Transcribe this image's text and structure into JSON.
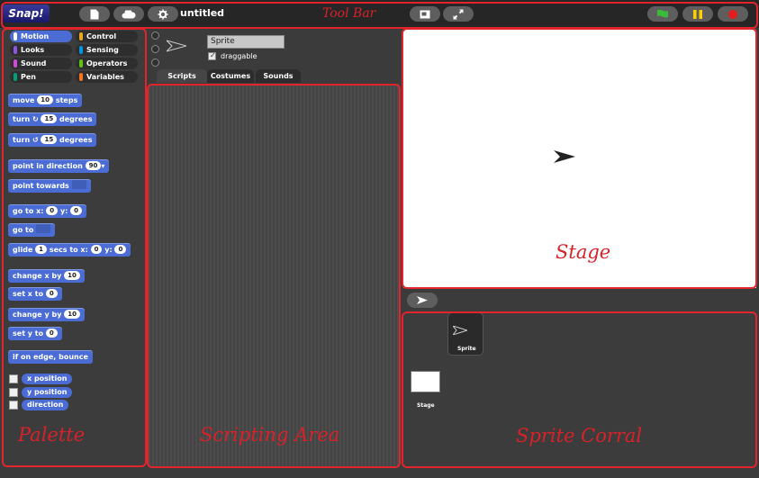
{
  "toolbar": {
    "logo_text": "Snap!",
    "project_title": "untitled"
  },
  "annotations": {
    "toolbar": "Tool Bar",
    "palette": "Palette",
    "scripting_area": "Scripting Area",
    "stage": "Stage",
    "sprite_corral": "Sprite Corral"
  },
  "categories": [
    {
      "label": "Motion",
      "color": "#4a6cd4"
    },
    {
      "label": "Control",
      "color": "#e6a822"
    },
    {
      "label": "Looks",
      "color": "#8f56e3"
    },
    {
      "label": "Sensing",
      "color": "#0494dc"
    },
    {
      "label": "Sound",
      "color": "#cf4ad9"
    },
    {
      "label": "Operators",
      "color": "#62c213"
    },
    {
      "label": "Pen",
      "color": "#00a178"
    },
    {
      "label": "Variables",
      "color": "#f3761d"
    }
  ],
  "blocks": {
    "move": {
      "pre": "move",
      "value": "10",
      "post": "steps"
    },
    "turn_cw": {
      "pre": "turn",
      "value": "15",
      "post": "degrees"
    },
    "turn_ccw": {
      "pre": "turn",
      "value": "15",
      "post": "degrees"
    },
    "point_dir": {
      "pre": "point in direction",
      "value": "90"
    },
    "point_towards": {
      "pre": "point towards"
    },
    "go_to_xy": {
      "pre": "go to x:",
      "x": "0",
      "mid": "y:",
      "y": "0"
    },
    "go_to": {
      "pre": "go to"
    },
    "glide": {
      "pre": "glide",
      "secs": "1",
      "mid1": "secs to x:",
      "x": "0",
      "mid2": "y:",
      "y": "0"
    },
    "change_x": {
      "pre": "change x by",
      "value": "10"
    },
    "set_x": {
      "pre": "set x to",
      "value": "0"
    },
    "change_y": {
      "pre": "change y by",
      "value": "10"
    },
    "set_y": {
      "pre": "set y to",
      "value": "0"
    },
    "bounce": {
      "label": "if on edge, bounce"
    }
  },
  "reporters": [
    "x position",
    "y position",
    "direction"
  ],
  "sprite": {
    "name": "Sprite",
    "draggable_label": "draggable"
  },
  "tabs": [
    "Scripts",
    "Costumes",
    "Sounds"
  ],
  "corral": {
    "sprite_label": "Sprite",
    "stage_label": "Stage"
  }
}
